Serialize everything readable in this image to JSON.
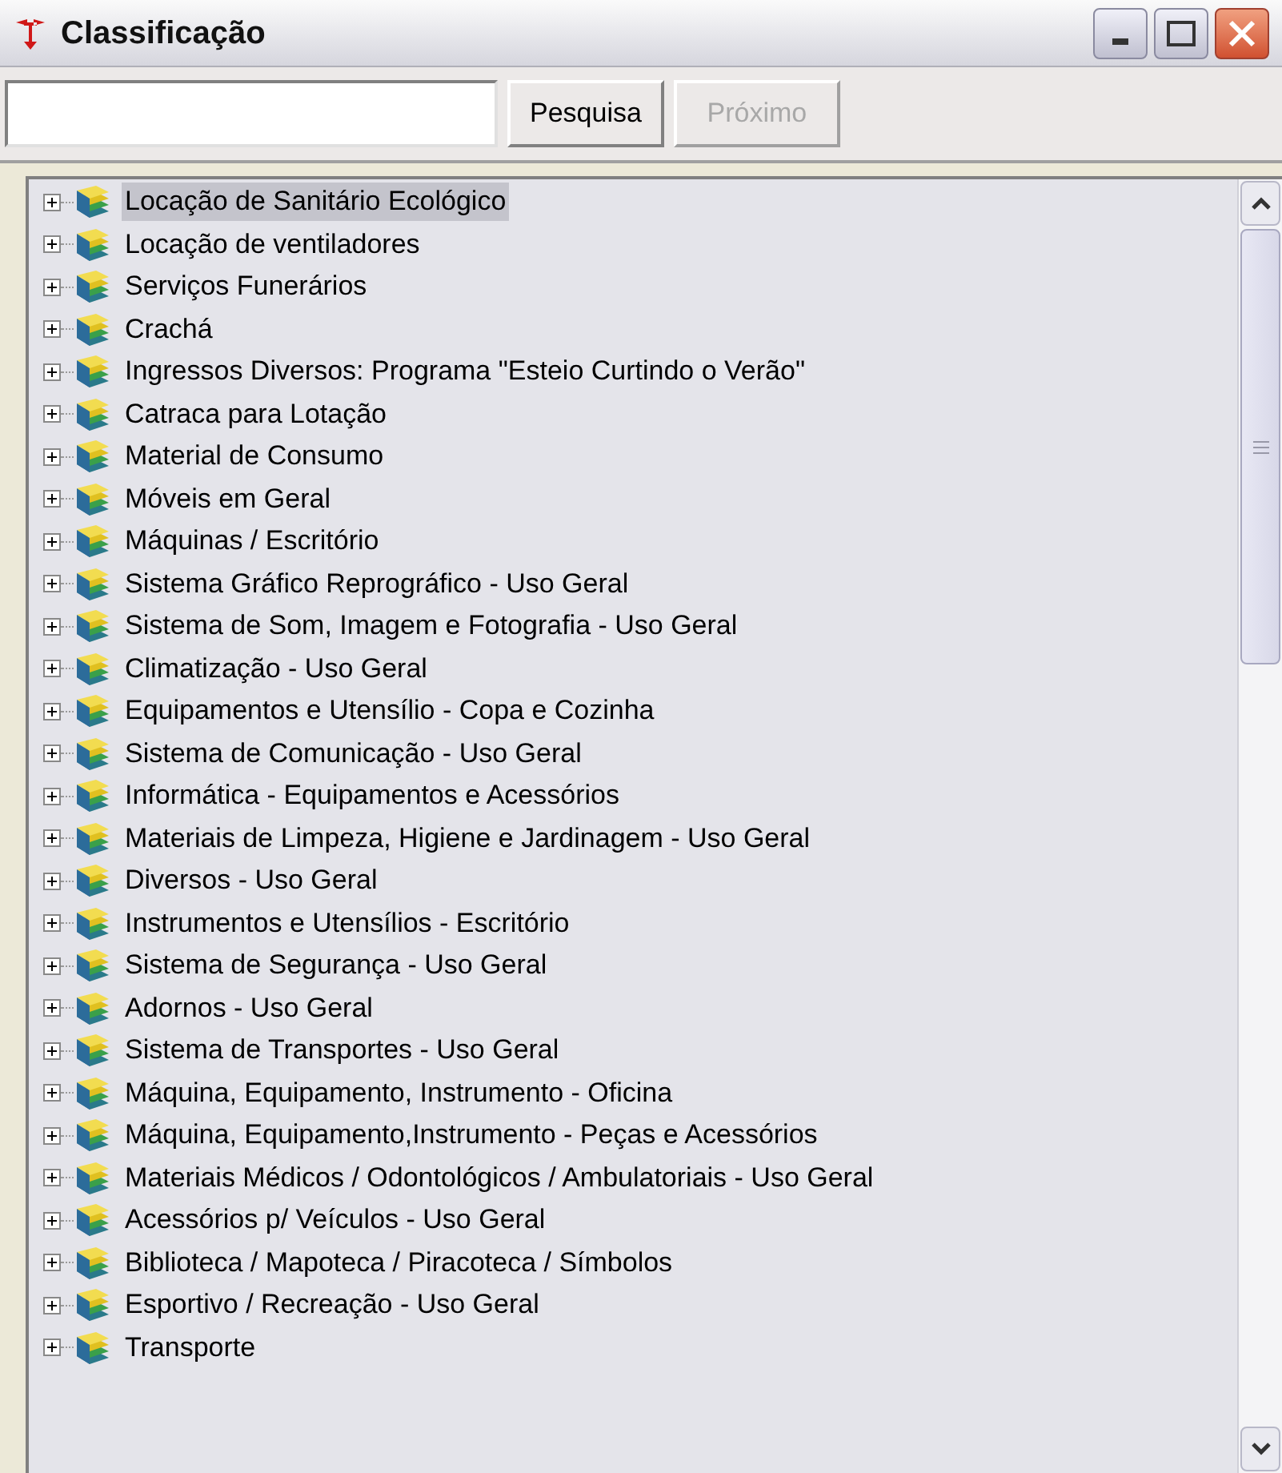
{
  "window": {
    "title": "Classificação"
  },
  "search": {
    "button": "Pesquisa",
    "next_button": "Próximo",
    "next_disabled": true
  },
  "tree": [
    {
      "label": "Locação de Sanitário Ecológico",
      "selected": true
    },
    {
      "label": "Locação de ventiladores",
      "selected": false
    },
    {
      "label": "Serviços Funerários",
      "selected": false
    },
    {
      "label": "Crachá",
      "selected": false
    },
    {
      "label": "Ingressos Diversos: Programa \"Esteio Curtindo o Verão\"",
      "selected": false
    },
    {
      "label": "Catraca para Lotação",
      "selected": false
    },
    {
      "label": "Material de Consumo",
      "selected": false
    },
    {
      "label": "Móveis em Geral",
      "selected": false
    },
    {
      "label": "Máquinas / Escritório",
      "selected": false
    },
    {
      "label": "Sistema Gráfico Reprográfico - Uso Geral",
      "selected": false
    },
    {
      "label": "Sistema de Som, Imagem e Fotografia - Uso Geral",
      "selected": false
    },
    {
      "label": "Climatização - Uso Geral",
      "selected": false
    },
    {
      "label": "Equipamentos e Utensílio - Copa e Cozinha",
      "selected": false
    },
    {
      "label": "Sistema de Comunicação - Uso Geral",
      "selected": false
    },
    {
      "label": "Informática - Equipamentos e Acessórios",
      "selected": false
    },
    {
      "label": "Materiais de Limpeza, Higiene e Jardinagem  - Uso Geral",
      "selected": false
    },
    {
      "label": "Diversos - Uso Geral",
      "selected": false
    },
    {
      "label": "Instrumentos e Utensílios - Escritório",
      "selected": false
    },
    {
      "label": "Sistema de Segurança - Uso Geral",
      "selected": false
    },
    {
      "label": "Adornos - Uso Geral",
      "selected": false
    },
    {
      "label": "Sistema de Transportes - Uso Geral",
      "selected": false
    },
    {
      "label": "Máquina, Equipamento, Instrumento - Oficina",
      "selected": false
    },
    {
      "label": "Máquina, Equipamento,Instrumento - Peças e Acessórios",
      "selected": false
    },
    {
      "label": "Materiais Médicos / Odontológicos / Ambulatoriais - Uso Geral",
      "selected": false
    },
    {
      "label": "Acessórios p/ Veículos - Uso Geral",
      "selected": false
    },
    {
      "label": "Biblioteca / Mapoteca / Piracoteca / Símbolos",
      "selected": false
    },
    {
      "label": "Esportivo / Recreação - Uso Geral",
      "selected": false
    },
    {
      "label": "Transporte",
      "selected": false
    }
  ]
}
